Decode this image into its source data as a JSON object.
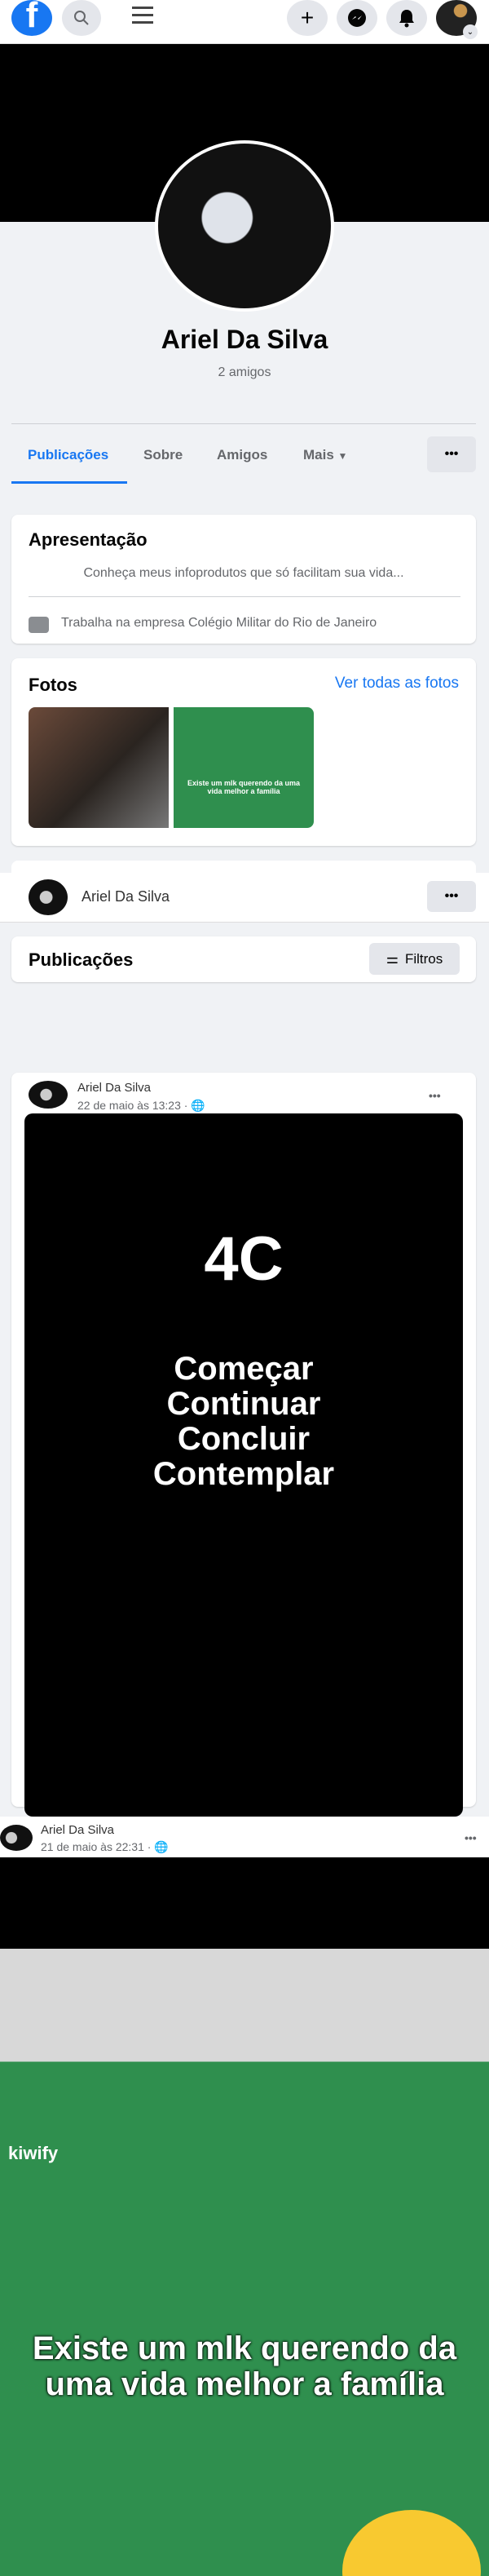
{
  "header": {
    "icons": [
      "facebook-logo",
      "search-icon",
      "menu-icon",
      "plus-icon",
      "messenger-icon",
      "bell-icon",
      "account-avatar"
    ]
  },
  "profile": {
    "name": "Ariel Da Silva",
    "friends": "2 amigos"
  },
  "tabs": [
    {
      "label": "Publicações",
      "active": true
    },
    {
      "label": "Sobre"
    },
    {
      "label": "Amigos"
    },
    {
      "label": "Mais"
    }
  ],
  "intro": {
    "title": "Apresentação",
    "bio": "Conheça meus infoprodutos que só facilitam sua vida...",
    "work": "Trabalha na empresa Colégio Militar do Rio de Janeiro"
  },
  "photos": {
    "title": "Fotos",
    "see_all": "Ver todas as fotos",
    "photo2_caption": "Existe um mlk querendo da uma vida melhor a família"
  },
  "sticky": {
    "name": "Ariel Da Silva"
  },
  "posts_section": {
    "title": "Publicações",
    "filters": "Filtros"
  },
  "posts": [
    {
      "author": "Ariel Da Silva",
      "date": "22 de maio às 13:23 ·",
      "image_lines": [
        "4C",
        "Começar",
        "Continuar",
        "Concluir",
        "Contemplar"
      ]
    },
    {
      "author": "Ariel Da Silva",
      "date": "21 de maio às 22:31 ·",
      "caption": "Existe um mlk querendo da uma vida melhor a família",
      "brand": "kiwify"
    }
  ],
  "colors": {
    "accent": "#1877f2",
    "kiwify_green": "#2f8f4e"
  }
}
